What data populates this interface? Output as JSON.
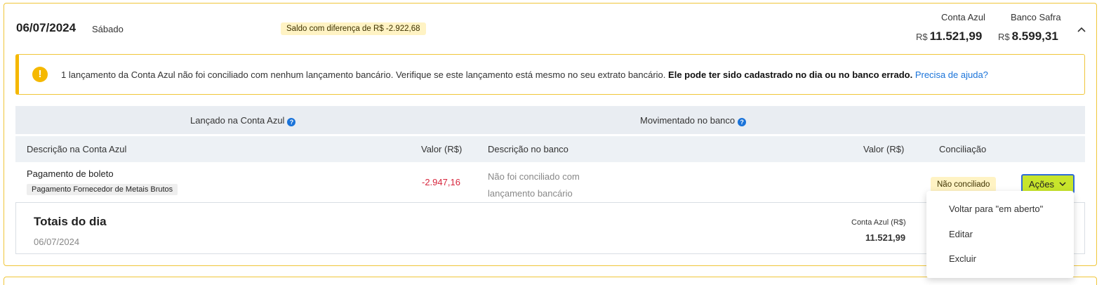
{
  "header": {
    "date": "06/07/2024",
    "weekday": "Sábado",
    "diff_badge": "Saldo com diferença de R$ -2.922,68",
    "balances": [
      {
        "label": "Conta Azul",
        "currency": "R$",
        "value": "11.521,99"
      },
      {
        "label": "Banco Safra",
        "currency": "R$",
        "value": "8.599,31"
      }
    ],
    "collapse_icon": "chevron-up-icon"
  },
  "alert": {
    "icon": "warning-icon",
    "text": "1 lançamento da Conta Azul não foi conciliado com nenhum lançamento bancário. Verifique se este lançamento está mesmo no seu extrato bancário.",
    "bold": "Ele pode ter sido cadastrado no dia ou no banco errado.",
    "link": "Precisa de ajuda?",
    "color": "#f5b800"
  },
  "groups": {
    "left": "Lançado na Conta Azul",
    "right": "Movimentado no banco",
    "help_glyph": "?"
  },
  "columns": {
    "desc_conta": "Descrição na Conta Azul",
    "valor_conta": "Valor (R$)",
    "desc_banco": "Descrição no banco",
    "valor_banco": "Valor (R$)",
    "conciliacao": "Conciliação"
  },
  "row": {
    "description": "Pagamento de boleto",
    "tag": "Pagamento Fornecedor de Metais Brutos",
    "value": "-2.947,16",
    "bank_line1": "Não foi conciliado com",
    "bank_line2": "lançamento bancário",
    "status": "Não conciliado",
    "actions_label": "Ações"
  },
  "totals": {
    "title": "Totais do dia",
    "date": "06/07/2024",
    "label": "Conta Azul (R$)",
    "value": "11.521,99"
  },
  "dropdown": {
    "items": [
      "Voltar para \"em aberto\"",
      "Editar",
      "Excluir"
    ]
  },
  "colors": {
    "accent_border": "#f0c63a",
    "actions_bg": "#c8e52b",
    "negative": "#d7263d",
    "link": "#1a73d9"
  }
}
